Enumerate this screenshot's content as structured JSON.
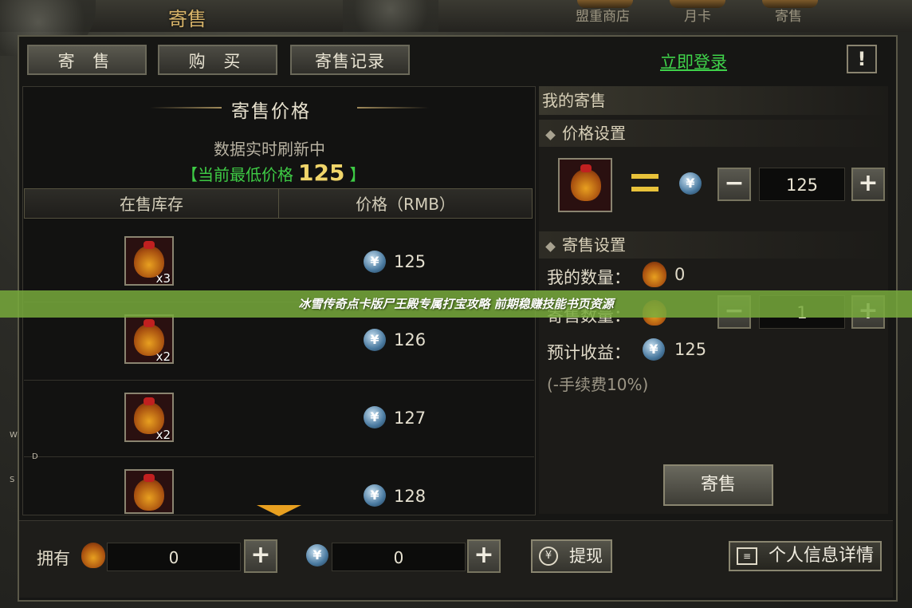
{
  "header": {
    "title": "寄售",
    "top_tabs": [
      "盟重商店",
      "月卡",
      "寄售"
    ]
  },
  "tabs": [
    "寄 售",
    "购 买",
    "寄售记录"
  ],
  "login_link": "立即登录",
  "alert_icon": "!",
  "price_panel": {
    "title": "寄售价格",
    "refresh_text": "数据实时刷新中",
    "lowest_prefix": "【当前最低价格",
    "lowest_value": "125",
    "lowest_suffix": "】",
    "columns": [
      "在售库存",
      "价格（RMB）"
    ],
    "rows": [
      {
        "qty": "x3",
        "price": "125"
      },
      {
        "qty": "x2",
        "price": "126"
      },
      {
        "qty": "x2",
        "price": "127"
      },
      {
        "qty": "",
        "price": "128"
      }
    ]
  },
  "my_sale": {
    "title": "我的寄售",
    "price_settings": {
      "heading": "价格设置",
      "value": "125",
      "minus": "−",
      "plus": "+"
    },
    "sale_settings": {
      "heading": "寄售设置",
      "my_quantity_label": "我的数量：",
      "my_quantity": "0",
      "sale_quantity_label": "寄售数量：",
      "sale_quantity": "1",
      "expected_label": "预计收益：",
      "expected_value": "125",
      "fee_note": "(-手续费10%)"
    },
    "sell_button": "寄售"
  },
  "bottom": {
    "own_label": "拥有",
    "item_value": "0",
    "rmb_value": "0",
    "plus": "+",
    "withdraw": "提现",
    "info": "个人信息详情"
  },
  "banner_text": "冰雪传奇点卡版尸王殿专属打宝攻略 前期稳赚技能书页资源",
  "side_letters": [
    "W",
    "D",
    "S"
  ],
  "currency_symbol": "¥",
  "colors": {
    "accent_green": "#3ecb45",
    "gold": "#f0d56a",
    "banner": "#78aa3c"
  }
}
